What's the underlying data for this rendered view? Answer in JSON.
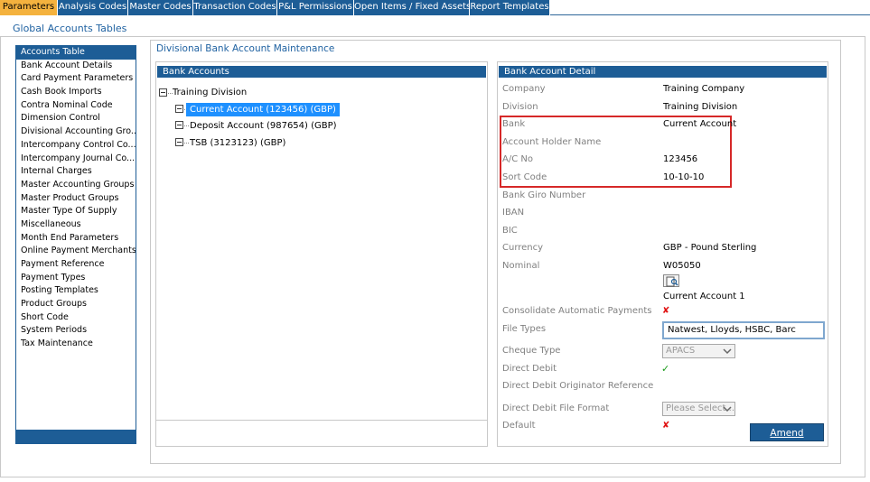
{
  "tabs": [
    {
      "label": "Parameters",
      "active": true
    },
    {
      "label": "Analysis Codes"
    },
    {
      "label": "Master Codes"
    },
    {
      "label": "Transaction Codes"
    },
    {
      "label": "P&L Permissions"
    },
    {
      "label": "Open Items / Fixed Assets"
    },
    {
      "label": "Report Templates"
    }
  ],
  "page_title": "Global Accounts Tables",
  "sidebar": {
    "items": [
      {
        "label": "Accounts Table"
      },
      {
        "label": "Bank Account Details"
      },
      {
        "label": "Card Payment Parameters"
      },
      {
        "label": "Cash Book Imports"
      },
      {
        "label": "Contra Nominal Code"
      },
      {
        "label": "Dimension Control"
      },
      {
        "label": "Divisional Accounting Gro..."
      },
      {
        "label": "Intercompany Control Co..."
      },
      {
        "label": "Intercompany Journal Co..."
      },
      {
        "label": "Internal Charges"
      },
      {
        "label": "Master Accounting Groups"
      },
      {
        "label": "Master Product Groups"
      },
      {
        "label": "Master Type Of Supply"
      },
      {
        "label": "Miscellaneous"
      },
      {
        "label": "Month End Parameters"
      },
      {
        "label": "Online Payment Merchants"
      },
      {
        "label": "Payment Reference"
      },
      {
        "label": "Payment Types"
      },
      {
        "label": "Posting Templates"
      },
      {
        "label": "Product Groups"
      },
      {
        "label": "Short Code"
      },
      {
        "label": "System Periods"
      },
      {
        "label": "Tax Maintenance"
      }
    ]
  },
  "main": {
    "title": "Divisional Bank Account Maintenance",
    "bank_accounts": {
      "header": "Bank Accounts",
      "root": "Training Division",
      "children": [
        {
          "label": "Current Account (123456) (GBP)"
        },
        {
          "label": "Deposit Account (987654) (GBP)"
        },
        {
          "label": "TSB (3123123) (GBP)"
        }
      ]
    },
    "detail": {
      "header": "Bank Account Detail",
      "company_label": "Company",
      "company_value": "Training Company",
      "division_label": "Division",
      "division_value": "Training Division",
      "bank_label": "Bank",
      "bank_value": "Current Account",
      "holder_label": "Account Holder Name",
      "holder_value": "",
      "acno_label": "A/C No",
      "acno_value": "123456",
      "sort_label": "Sort Code",
      "sort_value": "10-10-10",
      "giro_label": "Bank Giro Number",
      "iban_label": "IBAN",
      "bic_label": "BIC",
      "currency_label": "Currency",
      "currency_value": "GBP - Pound Sterling",
      "nominal_label": "Nominal",
      "nominal_value": "W05050",
      "nominal_desc": "Current Account 1",
      "consolidate_label": "Consolidate Automatic Payments",
      "consolidate_mark": "✘",
      "file_types_label": "File Types",
      "file_types_value": "Natwest, Lloyds, HSBC, Barc",
      "cheque_type_label": "Cheque Type",
      "cheque_type_value": "APACS",
      "direct_debit_label": "Direct Debit",
      "direct_debit_mark": "✓",
      "dd_originator_label": "Direct Debit Originator Reference",
      "dd_format_label": "Direct Debit File Format",
      "dd_format_value": "Please Select...",
      "default_label": "Default",
      "default_mark": "✘",
      "amend_label": "Amend"
    }
  },
  "colors": {
    "accent": "#1d5d96",
    "active_tab": "#f4b23e",
    "selection": "#1e90ff",
    "highlight": "#d62828"
  }
}
